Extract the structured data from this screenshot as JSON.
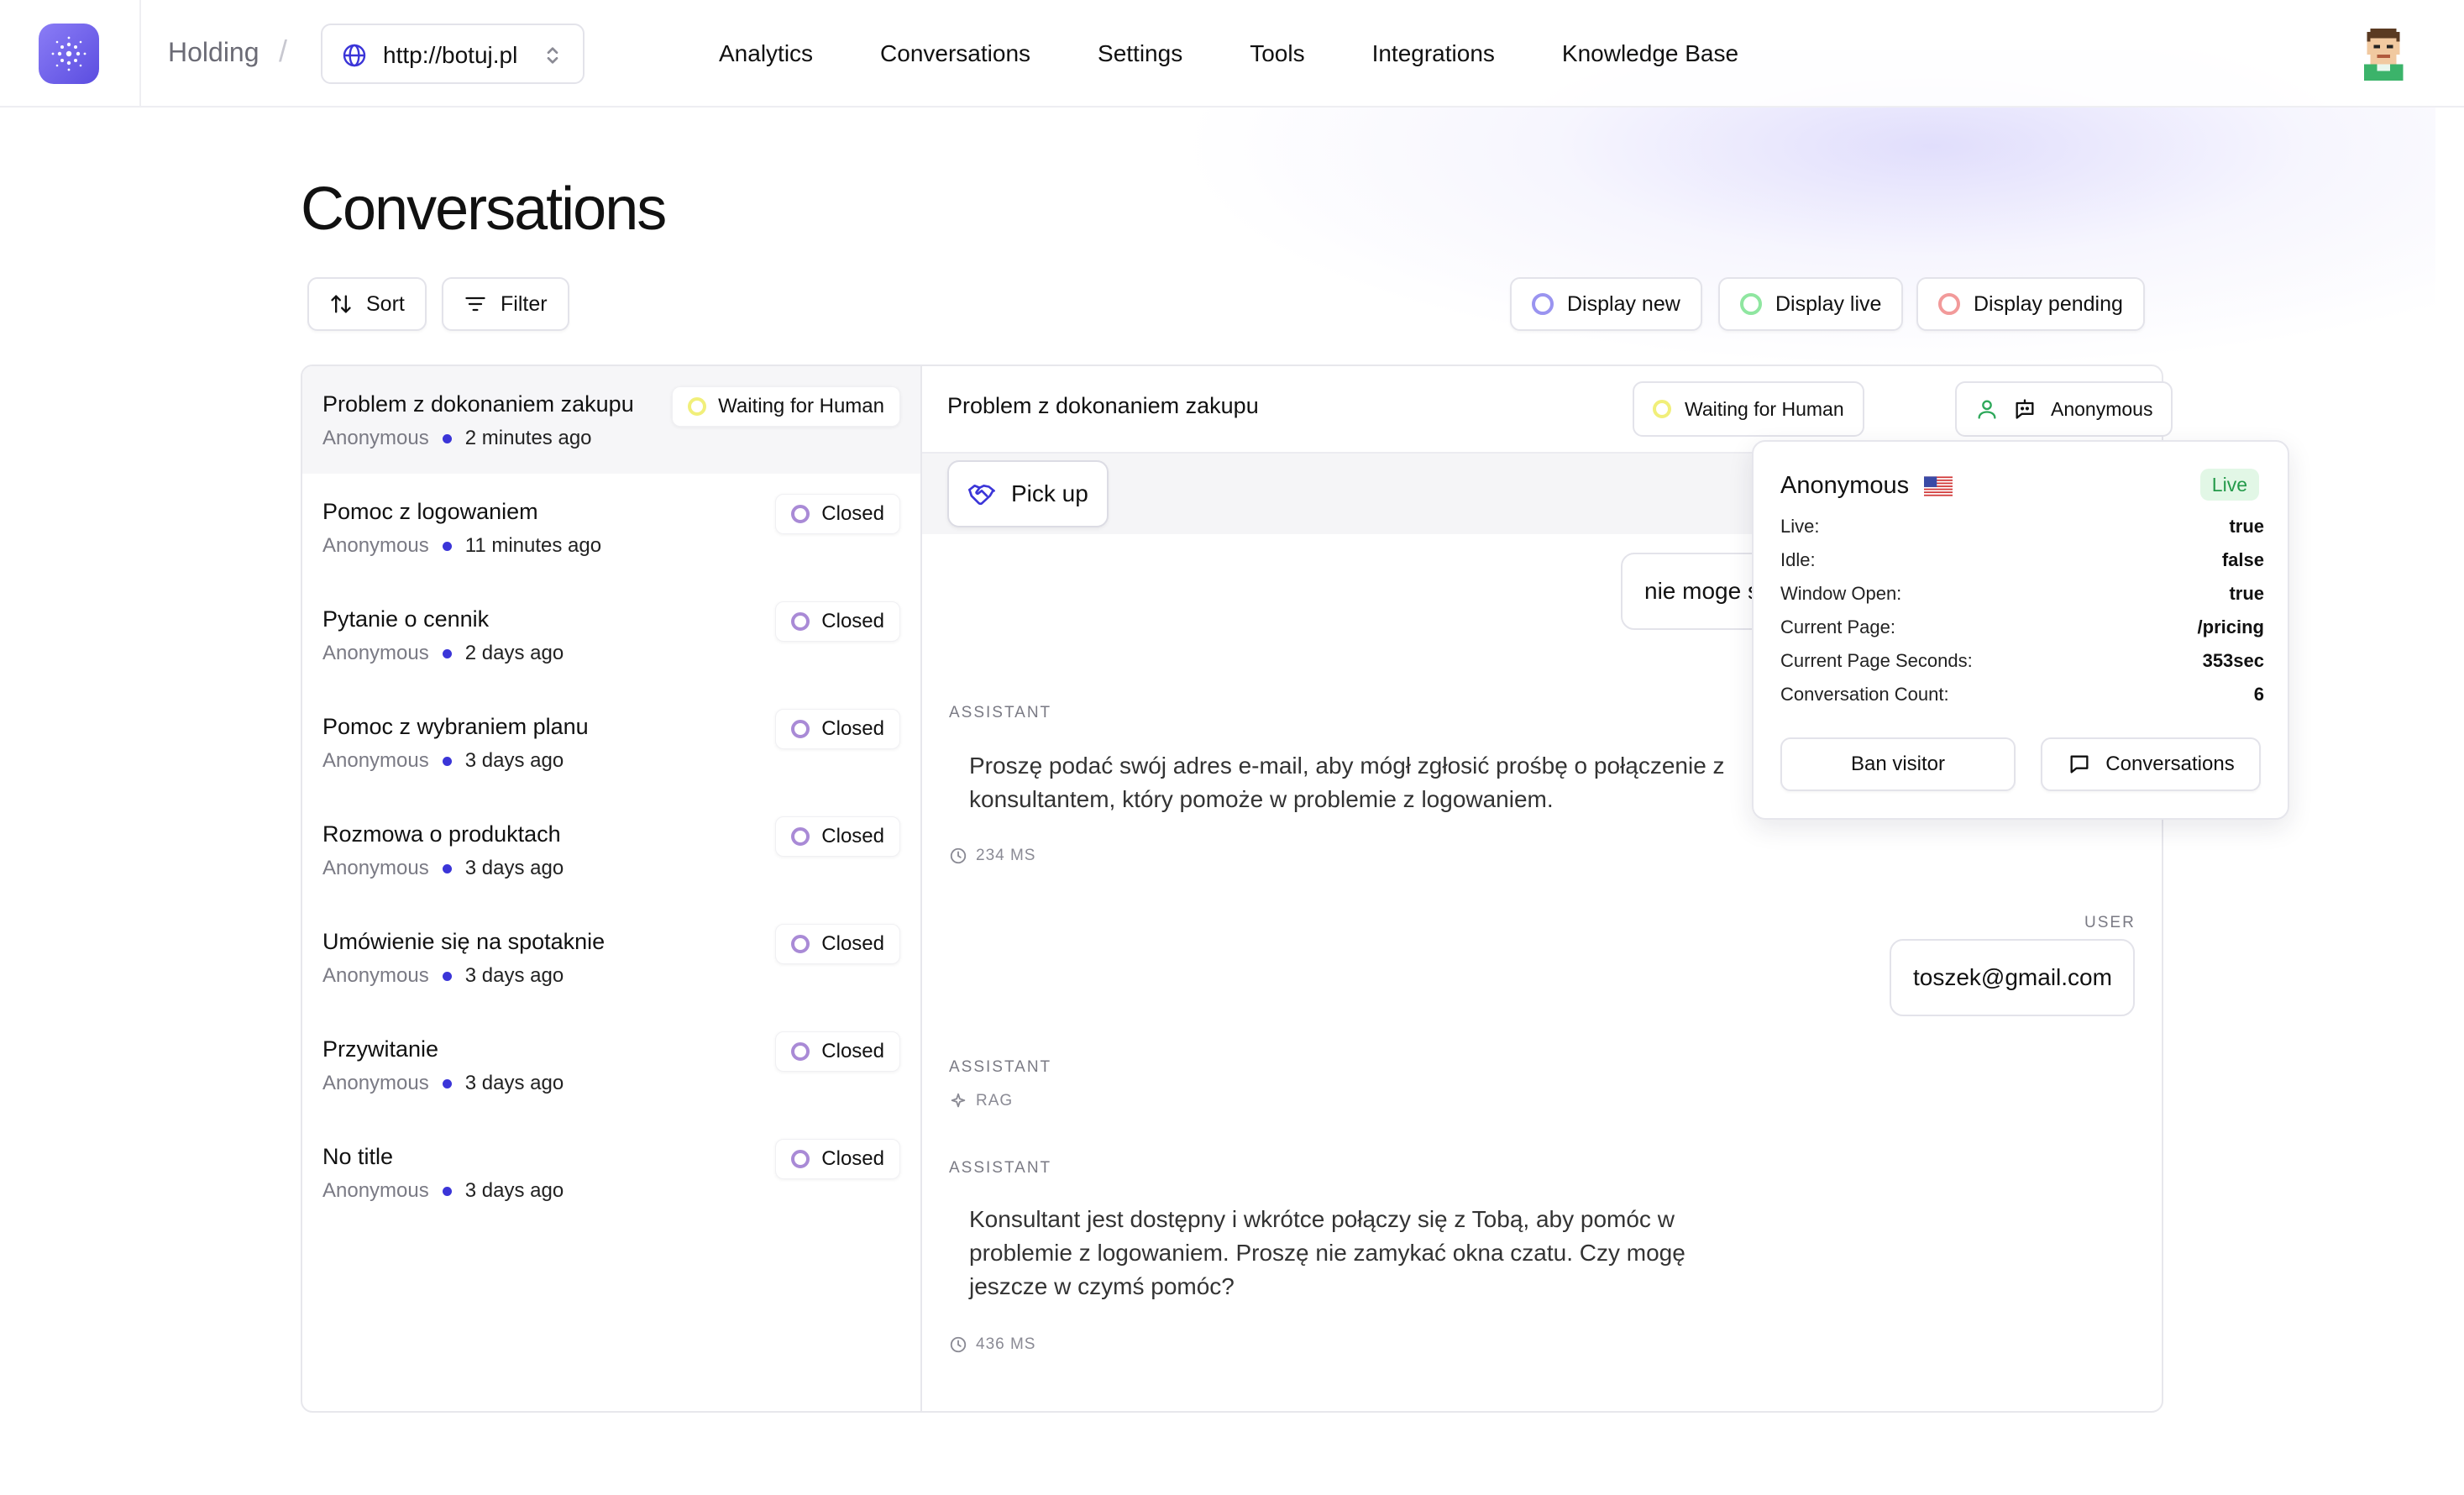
{
  "header": {
    "org": "Holding",
    "domain": "http://botuj.pl",
    "nav": [
      "Analytics",
      "Conversations",
      "Settings",
      "Tools",
      "Integrations",
      "Knowledge Base"
    ]
  },
  "page": {
    "title": "Conversations",
    "sort_label": "Sort",
    "filter_label": "Filter",
    "display_new": "Display new",
    "display_live": "Display live",
    "display_pending": "Display pending"
  },
  "colors": {
    "accent": "#3b35d8",
    "new": "#9a94f0",
    "live": "#8fe6a0",
    "pending": "#f29a9a",
    "waiting": "#f1ef7a",
    "closed": "#a98ad6"
  },
  "conversations": [
    {
      "title": "Problem z dokonaniem zakupu",
      "user": "Anonymous",
      "time": "2 minutes ago",
      "status": "Waiting for Human"
    },
    {
      "title": "Pomoc z logowaniem",
      "user": "Anonymous",
      "time": "11 minutes ago",
      "status": "Closed"
    },
    {
      "title": "Pytanie o cennik",
      "user": "Anonymous",
      "time": "2 days ago",
      "status": "Closed"
    },
    {
      "title": "Pomoc z wybraniem planu",
      "user": "Anonymous",
      "time": "3 days ago",
      "status": "Closed"
    },
    {
      "title": "Rozmowa o produktach",
      "user": "Anonymous",
      "time": "3 days ago",
      "status": "Closed"
    },
    {
      "title": "Umówienie się na spotaknie",
      "user": "Anonymous",
      "time": "3 days ago",
      "status": "Closed"
    },
    {
      "title": "Przywitanie",
      "user": "Anonymous",
      "time": "3 days ago",
      "status": "Closed"
    },
    {
      "title": "No title",
      "user": "Anonymous",
      "time": "3 days ago",
      "status": "Closed"
    }
  ],
  "chat": {
    "title": "Problem z dokonaniem zakupu",
    "status": "Waiting for Human",
    "visitor": "Anonymous",
    "pickup_label": "Pick up",
    "first_user_msg": "nie moge s",
    "assistant_label": "ASSISTANT",
    "user_label": "USER",
    "msg1": "Proszę podać swój adres e-mail, aby mógł zgłosić prośbę o połączenie z konsultantem, który pomoże w problemie z logowaniem.",
    "msg1_latency": "234 MS",
    "user_msg2": "toszek@gmail.com",
    "rag_label": "RAG",
    "msg2": "Konsultant jest dostępny i wkrótce połączy się z Tobą, aby pomóc w problemie z logowaniem. Proszę nie zamykać okna czatu. Czy mogę jeszcze w czymś pomóc?",
    "msg2_latency": "436 MS"
  },
  "visitor_popover": {
    "name": "Anonymous",
    "status": "Live",
    "fields": [
      {
        "k": "Live:",
        "v": "true"
      },
      {
        "k": "Idle:",
        "v": "false"
      },
      {
        "k": "Window Open:",
        "v": "true"
      },
      {
        "k": "Current Page:",
        "v": "/pricing"
      },
      {
        "k": "Current Page Seconds:",
        "v": "353sec"
      },
      {
        "k": "Conversation Count:",
        "v": "6"
      }
    ],
    "ban_label": "Ban visitor",
    "conversations_label": "Conversations"
  }
}
